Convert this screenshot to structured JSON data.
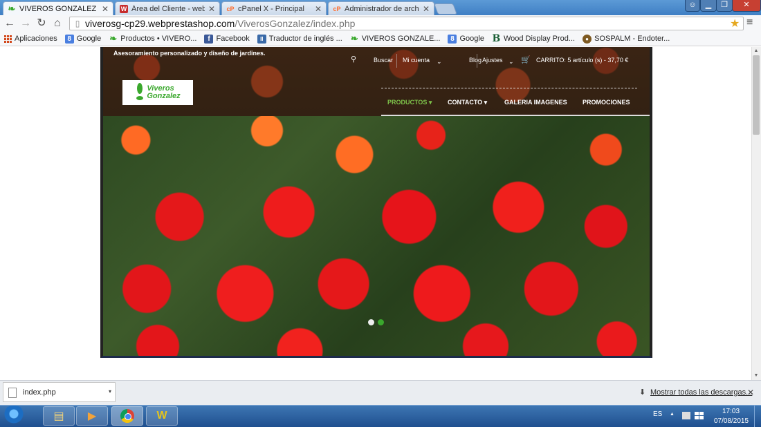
{
  "browser": {
    "tabs": [
      {
        "title": "VIVEROS GONZALEZ - GA",
        "icon": "leaf-icon",
        "active": true
      },
      {
        "title": "Área del Cliente - webem",
        "icon": "webempresa-icon",
        "active": false
      },
      {
        "title": "cPanel X - Principal",
        "icon": "cpanel-icon",
        "active": false
      },
      {
        "title": "Administrador de archivos",
        "icon": "cpanel-icon",
        "active": false
      }
    ],
    "url_host": "viverosg-cp29.webprestashop.com",
    "url_path": "/ViverosGonzalez/index.php",
    "bookmarks": [
      {
        "label": "Aplicaciones",
        "icon": "apps-icon"
      },
      {
        "label": "Google",
        "icon": "google-icon"
      },
      {
        "label": "Productos • VIVERO...",
        "icon": "leaf-icon"
      },
      {
        "label": "Facebook",
        "icon": "facebook-icon"
      },
      {
        "label": "Traductor de inglés ...",
        "icon": "translator-icon"
      },
      {
        "label": "VIVEROS GONZALE...",
        "icon": "leaf-icon"
      },
      {
        "label": "Google",
        "icon": "google-icon"
      },
      {
        "label": "Wood Display Prod...",
        "icon": "b-icon"
      },
      {
        "label": "SOSPALM - Endoter...",
        "icon": "sospalm-icon"
      }
    ]
  },
  "site": {
    "tagline": "Asesoramiento personalizado y diseño de jardines.",
    "logo_line1": "Viveros",
    "logo_line2": "Gonzalez",
    "top_nav": {
      "search": "Buscar",
      "account": "Mi cuenta",
      "blog": "Blog",
      "settings": "Ajustes",
      "cart": "CARRITO: 5 artículo (s) - 37,70 €"
    },
    "menu": {
      "productos": "PRODUCTOS",
      "contacto": "CONTACTO",
      "galeria": "GALERIA IMAGENES",
      "promociones": "PROMOCIONES"
    },
    "slider": {
      "slides": 2,
      "active_slide": 1
    }
  },
  "downloads": {
    "file": "index.php",
    "show_all": "Mostrar todas las descargas..."
  },
  "taskbar": {
    "lang": "ES",
    "time": "17:03",
    "date": "07/08/2015"
  },
  "colors": {
    "menu_active": "#7ec24a",
    "brand_green": "#3aa82d",
    "taskbar": "#1f4f8f"
  }
}
